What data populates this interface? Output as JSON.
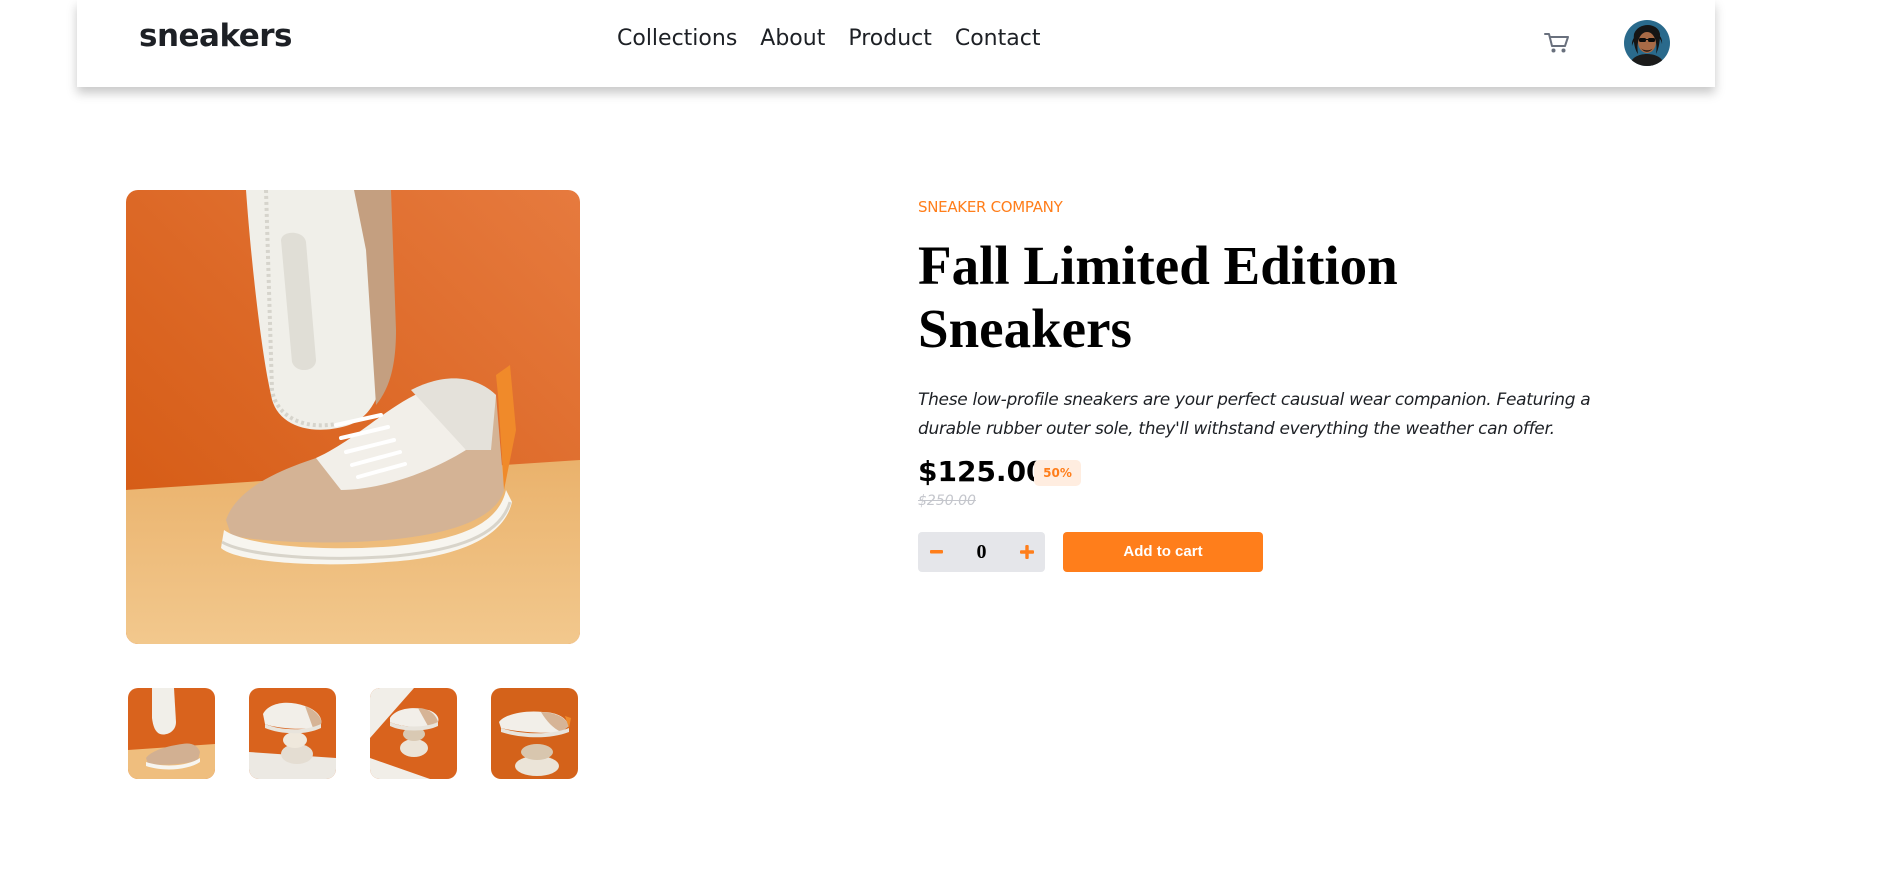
{
  "header": {
    "logo": "sneakers",
    "nav": [
      "Collections",
      "About",
      "Product",
      "Contact"
    ],
    "cart_icon": "cart-icon",
    "avatar_icon": "user-avatar"
  },
  "gallery": {
    "main_image": "sneaker-on-orange-background",
    "thumbnails": [
      "thumbnail-1",
      "thumbnail-2",
      "thumbnail-3",
      "thumbnail-4"
    ]
  },
  "product": {
    "company": "SNEAKER COMPANY",
    "title": "Fall Limited Edition Sneakers",
    "description": "These low-profile sneakers are your perfect causual wear companion. Featuring a durable rubber outer sole, they'll withstand everything the weather can offer.",
    "price": "$125.00",
    "discount": "50%",
    "old_price": "$250.00",
    "quantity": "0",
    "minus_icon": "minus-icon",
    "plus_icon": "plus-icon",
    "add_to_cart_label": "Add to cart"
  },
  "colors": {
    "accent": "#ff7e1b",
    "accent_pale": "#ffede0",
    "text_dark": "#1d2025",
    "muted": "#c4c6cc",
    "stepper_bg": "#e5e6ea"
  }
}
